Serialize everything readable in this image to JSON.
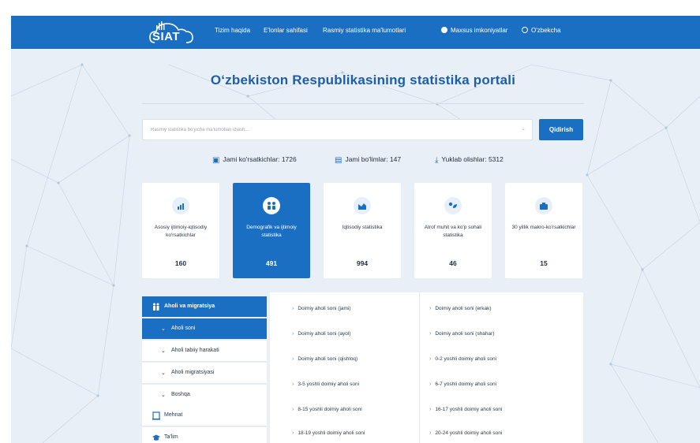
{
  "header": {
    "logo_text": "SIAT",
    "nav": [
      {
        "label": "Tizim haqida"
      },
      {
        "label": "E'lonlar sahifasi"
      },
      {
        "label": "Rasmiy statistika ma'lumotlari"
      },
      {
        "label": "Maxsus imkoniyatlar"
      },
      {
        "label": "O'zbekcha"
      }
    ]
  },
  "page": {
    "title": "O‘zbekiston Respublikasining statistika portali"
  },
  "search": {
    "placeholder": "Rasmiy statistika bo'yicha ma'lumotlari izlash...",
    "button_label": "Qidirish"
  },
  "stats": [
    {
      "label": "Jami ko'rsatkichlar: 1726",
      "icon": "indicators-icon"
    },
    {
      "label": "Jami bo'limlar: 147",
      "icon": "sections-icon"
    },
    {
      "label": "Yuklab olishlar: 5312",
      "icon": "download-icon"
    }
  ],
  "categories": [
    {
      "label": "Asosiy ijtimoiy-iqtisodiy ko'rsatkichlar",
      "count": "160",
      "icon": "chart-icon",
      "active": false
    },
    {
      "label": "Demografik va ijtimoiy statistika",
      "count": "491",
      "icon": "people-icon",
      "active": true
    },
    {
      "label": "Iqtisodiy statistika",
      "count": "994",
      "icon": "area-chart-icon",
      "active": false
    },
    {
      "label": "Atrof muhit va ko'p sohali statistika",
      "count": "46",
      "icon": "eco-icon",
      "active": false
    },
    {
      "label": "30 yillik makro-ko'rsatkichlar",
      "count": "15",
      "icon": "briefcase-icon",
      "active": false
    }
  ],
  "sidebar": {
    "items": [
      {
        "label": "Aholi va migratsiya"
      },
      {
        "label": "Aholi soni"
      },
      {
        "label": "Aholi tabiiy harakati"
      },
      {
        "label": "Aholi migratsiyasi"
      },
      {
        "label": "Boshqa"
      },
      {
        "label": "Mehnat"
      },
      {
        "label": "Ta'lim"
      }
    ]
  },
  "indicators": {
    "left": [
      "Doimiy aholi soni (jami)",
      "Doimiy aholi soni (ayol)",
      "Doimiy aholi soni (qishloq)",
      "3-5 yoshli doimiy aholi soni",
      "8-15 yoshli doimiy aholi soni",
      "18-19 yoshli doimiy aholi soni"
    ],
    "right": [
      "Doimiy aholi soni (erkak)",
      "Doimiy aholi soni (shahar)",
      "0-2 yoshli doimiy aholi soni",
      "6-7 yoshli doimiy aholi soni",
      "16-17 yoshli doimiy aholi soni",
      "20-24 yoshli doimiy aholi soni"
    ]
  },
  "colors": {
    "brand_blue": "#1a6fc2",
    "background": "#e9eff6",
    "title_blue": "#1c5fa8"
  }
}
